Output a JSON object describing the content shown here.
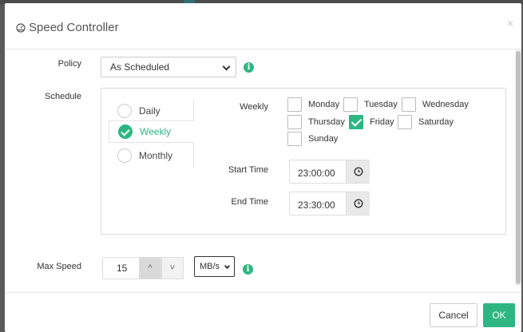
{
  "dialog": {
    "title": "Speed Controller",
    "close": "×"
  },
  "policy": {
    "label": "Policy",
    "value": "As Scheduled"
  },
  "schedule": {
    "label": "Schedule",
    "modes": [
      "Daily",
      "Weekly",
      "Monthly"
    ],
    "selected_mode": "Weekly",
    "weekly_label": "Weekly",
    "days": [
      {
        "name": "Monday",
        "checked": false
      },
      {
        "name": "Tuesday",
        "checked": false
      },
      {
        "name": "Wednesday",
        "checked": false
      },
      {
        "name": "Thursday",
        "checked": false
      },
      {
        "name": "Friday",
        "checked": true
      },
      {
        "name": "Saturday",
        "checked": false
      },
      {
        "name": "Sunday",
        "checked": false
      }
    ],
    "start_label": "Start Time",
    "start_time": "23:00:00",
    "end_label": "End Time",
    "end_time": "23:30:00"
  },
  "max_speed": {
    "label": "Max Speed",
    "value": "15",
    "unit": "MB/s",
    "up": "^",
    "down": "˅"
  },
  "footer": {
    "cancel": "Cancel",
    "ok": "OK"
  },
  "icons": {
    "title": "gauge-icon",
    "info": "info-icon",
    "time": "clock-icon"
  },
  "colors": {
    "accent": "#2eb682"
  }
}
